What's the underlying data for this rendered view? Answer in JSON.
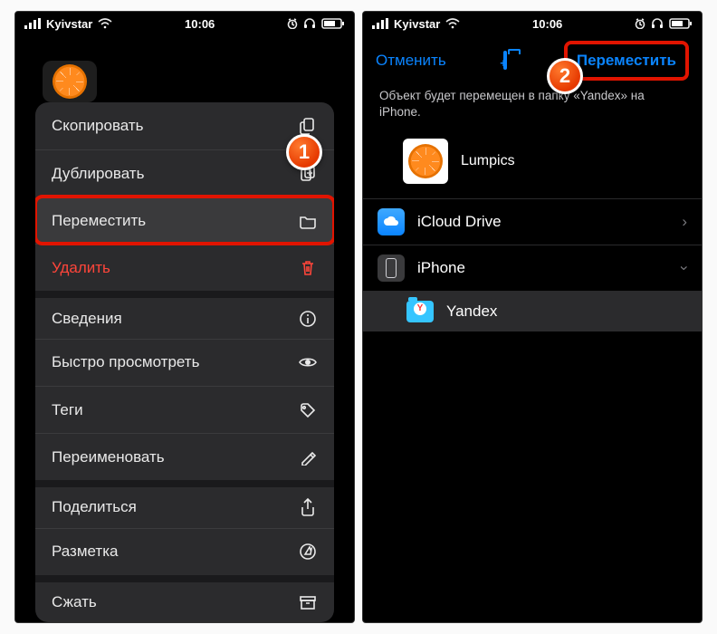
{
  "status": {
    "carrier": "Kyivstar",
    "time": "10:06"
  },
  "left": {
    "menu": [
      {
        "key": "copy",
        "label": "Скопировать",
        "icon": "copy-icon"
      },
      {
        "key": "duplicate",
        "label": "Дублировать",
        "icon": "duplicate-icon"
      },
      {
        "key": "move",
        "label": "Переместить",
        "icon": "folder-icon",
        "highlight": true
      },
      {
        "key": "delete",
        "label": "Удалить",
        "icon": "trash-icon",
        "danger": true
      },
      {
        "key": "info",
        "label": "Сведения",
        "icon": "info-icon",
        "gap": true
      },
      {
        "key": "quicklook",
        "label": "Быстро просмотреть",
        "icon": "eye-icon"
      },
      {
        "key": "tags",
        "label": "Теги",
        "icon": "tag-icon"
      },
      {
        "key": "rename",
        "label": "Переименовать",
        "icon": "pencil-icon"
      },
      {
        "key": "share",
        "label": "Поделиться",
        "icon": "share-icon",
        "gap": true
      },
      {
        "key": "markup",
        "label": "Разметка",
        "icon": "markup-icon"
      },
      {
        "key": "compress",
        "label": "Сжать",
        "icon": "archive-icon",
        "gap": true
      }
    ],
    "badge": "1"
  },
  "right": {
    "cancel": "Отменить",
    "move": "Переместить",
    "description": "Объект будет перемещен в папку «Yandex» на iPhone.",
    "file_name": "Lumpics",
    "locations": {
      "icloud": "iCloud Drive",
      "iphone": "iPhone",
      "yandex": "Yandex"
    },
    "badge": "2"
  }
}
